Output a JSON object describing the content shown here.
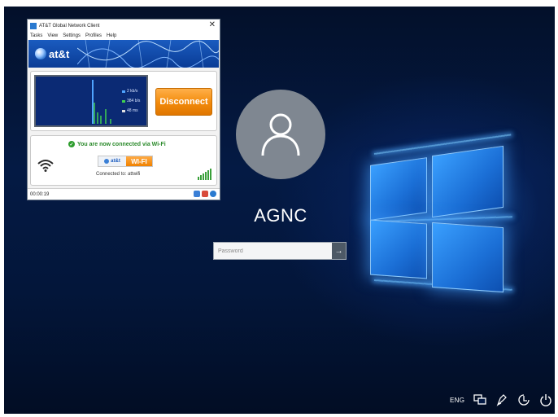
{
  "att_client": {
    "title": "AT&T Global Network Client",
    "menu": [
      "Tasks",
      "View",
      "Settings",
      "Profiles",
      "Help"
    ],
    "brand": "at&t",
    "graph_legend": [
      "2 kb/s",
      "384 b/s",
      "48 ms"
    ],
    "disconnect_label": "Disconnect",
    "status_message": "You are now connected via Wi-Fi",
    "badge_brand": "at&t",
    "badge_type": "WI-FI",
    "connected_to": "Connected to:  attwifi",
    "elapsed_time": "00:00:19",
    "colors": {
      "accent_orange": "#f28a0a",
      "brand_blue": "#1a5bbf",
      "success_green": "#2e9d2e"
    }
  },
  "login": {
    "username": "AGNC",
    "password_placeholder": "Password",
    "submit_icon": "arrow-right-icon"
  },
  "tray": {
    "language": "ENG",
    "icons": [
      "network-icon",
      "pen-icon",
      "accessibility-icon",
      "power-icon"
    ]
  }
}
